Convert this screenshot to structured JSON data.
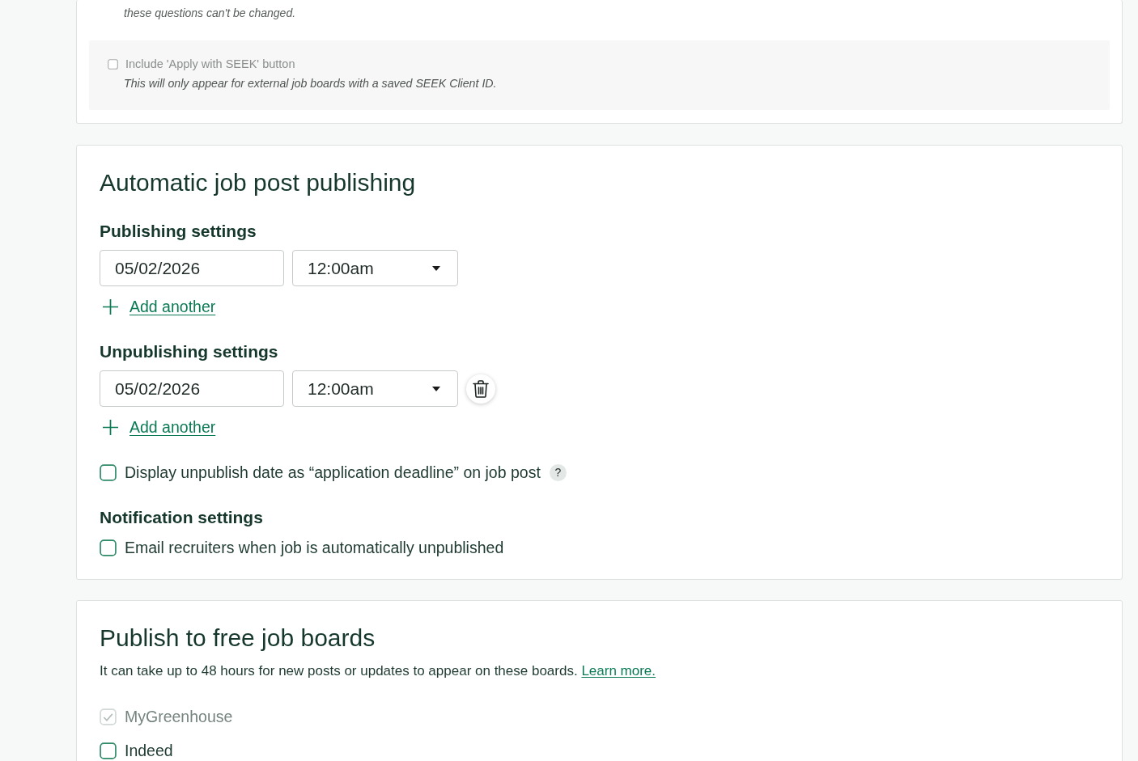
{
  "eeoc_section": {
    "description": "these questions can't be changed.",
    "seek_option": {
      "label": "Include 'Apply with SEEK' button",
      "checked": false,
      "disabled": true,
      "note": "This will only appear for external job boards with a saved SEEK Client ID."
    }
  },
  "auto_publishing": {
    "title": "Automatic job post publishing",
    "schedules": [
      {
        "heading": "Publishing settings",
        "rows": [
          {
            "date": "05/02/2026",
            "time": "12:00am",
            "deletable": false
          }
        ],
        "add_link": "Add another"
      },
      {
        "heading": "Unpublishing settings",
        "rows": [
          {
            "date": "05/02/2026",
            "time": "12:00am",
            "deletable": true
          }
        ],
        "add_link": "Add another"
      }
    ],
    "deadline_option": {
      "label": "Display unpublish date as “application deadline” on job post",
      "checked": false,
      "help": "?"
    },
    "notification": {
      "heading": "Notification settings",
      "options": [
        {
          "label": "Email recruiters when job is automatically unpublished",
          "checked": false
        }
      ]
    }
  },
  "job_boards": {
    "title": "Publish to free job boards",
    "description": "It can take up to 48 hours for new posts or updates to appear on these boards.",
    "link": "Learn more.",
    "boards": [
      {
        "label": "MyGreenhouse",
        "checked": true,
        "disabled": true
      },
      {
        "label": "Indeed",
        "checked": false,
        "disabled": false
      }
    ]
  }
}
